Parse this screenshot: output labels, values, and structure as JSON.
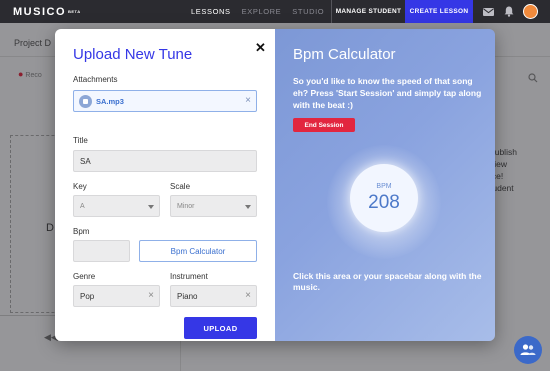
{
  "topbar": {
    "logo": "MUSICO",
    "logo_badge": "BETA",
    "nav": [
      "LESSONS",
      "EXPLORE",
      "STUDIO"
    ],
    "manage_student": "MANAGE STUDENT",
    "create_lesson": "CREATE LESSON",
    "icons": [
      "mail-icon",
      "bell-icon",
      "avatar"
    ]
  },
  "background": {
    "tab": "Project D",
    "record": "Reco",
    "dropzone_letter": "D",
    "right_text": [
      "publish",
      "view",
      "ice!",
      "tudent"
    ]
  },
  "modal": {
    "title": "Upload New Tune",
    "attachments_label": "Attachments",
    "attachment_file": "SA.mp3",
    "title_label": "Title",
    "title_value": "SA",
    "key_label": "Key",
    "key_value": "A",
    "scale_label": "Scale",
    "scale_value": "Minor",
    "bpm_label": "Bpm",
    "bpm_value": "",
    "bpm_calculator_button": "Bpm Calculator",
    "genre_label": "Genre",
    "genre_value": "Pop",
    "instrument_label": "Instrument",
    "instrument_value": "Piano",
    "upload_button": "UPLOAD"
  },
  "calculator": {
    "title": "Bpm Calculator",
    "description": "So you'd like to know the speed of that song eh? Press 'Start Session' and simply tap along with the beat :)",
    "end_session_button": "End Session",
    "bpm_label": "BPM",
    "bpm_value": "208",
    "hint": "Click this area or your spacebar along with the music."
  },
  "colors": {
    "accent": "#3537e6",
    "topbar": "#2b2b30",
    "end_session": "#e2263f",
    "panel": "#8aa3df"
  }
}
